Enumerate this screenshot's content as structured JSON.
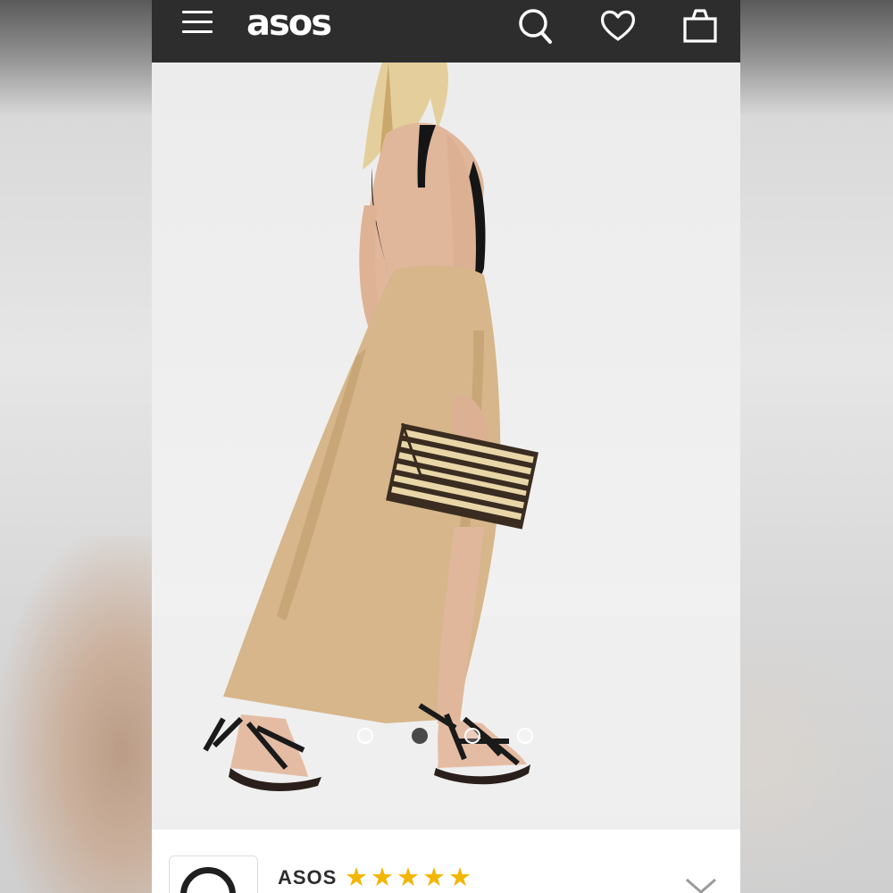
{
  "header": {
    "logo_text": "asos",
    "background": "#2d2d2d",
    "icons": [
      "hamburger-menu-icon",
      "search-icon",
      "heart-icon",
      "shopping-bag-icon"
    ]
  },
  "gallery": {
    "image_count": 4,
    "active_index": 1
  },
  "seller": {
    "name": "ASOS",
    "rating_stars": "★★★★★",
    "rating": 5,
    "star_color": "#f2b500"
  }
}
